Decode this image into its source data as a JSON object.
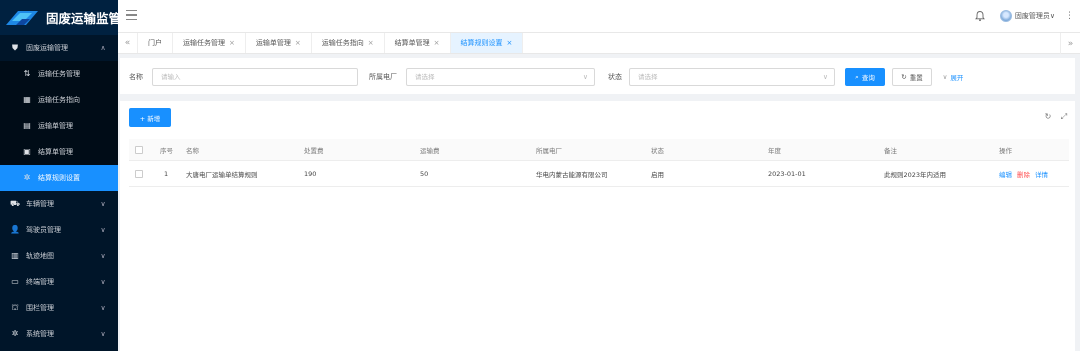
{
  "app": {
    "title": "固废运输监管"
  },
  "sidebar": {
    "items": [
      {
        "label": "固废运输管理",
        "icon": "shield-icon",
        "expanded": true
      },
      {
        "label": "运输任务管理",
        "icon": "tasks-icon"
      },
      {
        "label": "运输任务指向",
        "icon": "calendar-icon"
      },
      {
        "label": "运输单管理",
        "icon": "document-icon"
      },
      {
        "label": "结算单管理",
        "icon": "briefcase-icon"
      },
      {
        "label": "结算规则设置",
        "icon": "gear-icon",
        "active": true
      },
      {
        "label": "车辆管理",
        "icon": "truck-icon"
      },
      {
        "label": "驾驶员管理",
        "icon": "user-icon"
      },
      {
        "label": "轨迹地图",
        "icon": "map-icon"
      },
      {
        "label": "终端管理",
        "icon": "terminal-icon"
      },
      {
        "label": "围栏管理",
        "icon": "fence-icon"
      },
      {
        "label": "系统管理",
        "icon": "gear-icon"
      }
    ]
  },
  "header": {
    "user": "固废管理员∨",
    "more": "⋮"
  },
  "tabs": [
    {
      "label": "门户",
      "closable": false
    },
    {
      "label": "运输任务管理",
      "closable": true
    },
    {
      "label": "运输单管理",
      "closable": true
    },
    {
      "label": "运输任务指向",
      "closable": true
    },
    {
      "label": "结算单管理",
      "closable": true
    },
    {
      "label": "结算规则设置",
      "closable": true,
      "active": true
    }
  ],
  "filter": {
    "name_label": "名称",
    "name_placeholder": "请输入",
    "plant_label": "所属电厂",
    "plant_placeholder": "请选择",
    "status_label": "状态",
    "status_placeholder": "请选择",
    "search_label": "查询",
    "reset_label": "重置",
    "expand_label": "展开"
  },
  "toolbar": {
    "add_label": "+ 新增"
  },
  "table": {
    "columns": [
      "序号",
      "名称",
      "处置费",
      "运输费",
      "所属电厂",
      "状态",
      "年度",
      "备注",
      "操作"
    ],
    "rows": [
      {
        "index": "1",
        "name": "大唐电厂运输单结算规则",
        "disposal_fee": "190",
        "transport_fee": "50",
        "plant": "华电内蒙古能源有限公司",
        "status": "启用",
        "year": "2023-01-01",
        "remark": "此规则2023年内适用",
        "edit": "编辑",
        "delete": "删除",
        "detail": "详情"
      }
    ]
  },
  "colors": {
    "primary": "#1890ff",
    "sidebar_bg": "#001529",
    "danger": "#ff4d4f"
  }
}
